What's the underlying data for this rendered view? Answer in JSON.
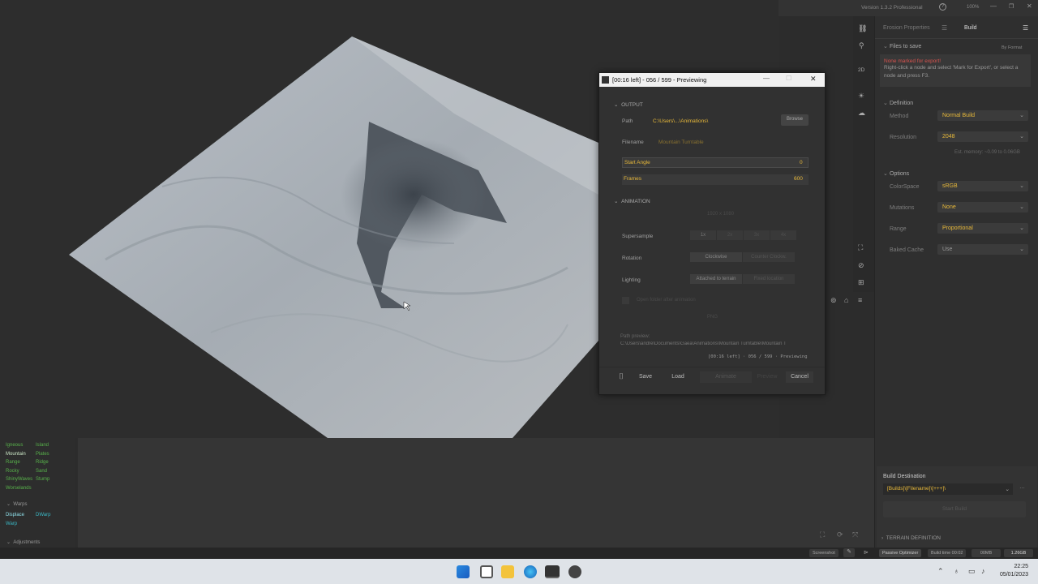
{
  "topbar": {
    "version": "Version 1.3.2 Professional",
    "zoom": "100%"
  },
  "panel": {
    "tabs": [
      "Erosion Properties",
      "Build"
    ],
    "files_section": "Files to save",
    "by_format": "By Format",
    "error_title": "None marked for export!",
    "error_body": "Right-click a node and select 'Mark for Export', or select a node and press F3.",
    "definition": "Definition",
    "method_label": "Method",
    "method_value": "Normal Build",
    "resolution_label": "Resolution",
    "resolution_value": "2048",
    "est_memory": "Est. memory: ~0.09 to 0.06GB",
    "options": "Options",
    "colorspace_label": "ColorSpace",
    "colorspace_value": "sRGB",
    "mutations_label": "Mutations",
    "mutations_value": "None",
    "range_label": "Range",
    "range_value": "Proportional",
    "baked_label": "Baked Cache",
    "baked_value": "Use",
    "build_dest_label": "Build Destination",
    "build_dest_value": "[Builds]\\[Filename]\\[+++]\\",
    "start_build": "Start Build",
    "terrain_def": "TERRAIN DEFINITION"
  },
  "iconstrip": {
    "mode_2d": "2D"
  },
  "dialog": {
    "title": "[00:16 left] - 056 / 599 - Previewing",
    "output": "OUTPUT",
    "path_label": "Path",
    "path_value": "C:\\Users\\...\\Animations\\",
    "browse": "Browse",
    "filename_label": "Filename",
    "filename_value": "Mountain Turntable",
    "start_angle_label": "Start Angle",
    "start_angle_value": "0",
    "frames_label": "Frames",
    "frames_value": "600",
    "animation": "ANIMATION",
    "resolution_dim": "1920 x 1080",
    "supersample_label": "Supersample",
    "supersample_opts": [
      "1x",
      "2x",
      "3x",
      "4x"
    ],
    "rotation_label": "Rotation",
    "rotation_opts": [
      "Clockwise",
      "Counter Clockw."
    ],
    "lighting_label": "Lighting",
    "lighting_opts": [
      "Attached to terrain",
      "Fixed location"
    ],
    "open_folder": "Open folder after animation",
    "format_value": "PNG",
    "path_preview_label": "Path preview:",
    "path_preview_value": "C:\\Users\\andre\\Documents\\Gaea\\Animations\\Mountain Turntable\\Mountain T",
    "progress": "[00:16 left] · 056 / 599 · Previewing",
    "save": "Save",
    "load": "Load",
    "animate": "Animate",
    "preview": "Preview",
    "cancel": "Cancel"
  },
  "nodes": {
    "col1": [
      "Igneous",
      "Mountain",
      "Range",
      "Rocky",
      "ShinyWaves",
      "Worselands"
    ],
    "col2": [
      "Island",
      "Plates",
      "Ridge",
      "Sand",
      "Stump"
    ],
    "warps_header": "Warps",
    "warps_col1": [
      "Displace",
      "Warp"
    ],
    "warps_col2": [
      "DWarp"
    ],
    "adjustments": "Adjustments"
  },
  "statusbar": {
    "screenshot": "Screenshot",
    "passive": "Passive Optimizer",
    "build_time": "Build time 00:02",
    "mem1": "00MB",
    "mem2": "1.26GB"
  },
  "taskbar": {
    "time": "22:25",
    "date": "05/01/2023"
  },
  "colors": {
    "accent": "#e8b93a",
    "node_green": "#58b24b",
    "error_red": "#d9534f"
  }
}
